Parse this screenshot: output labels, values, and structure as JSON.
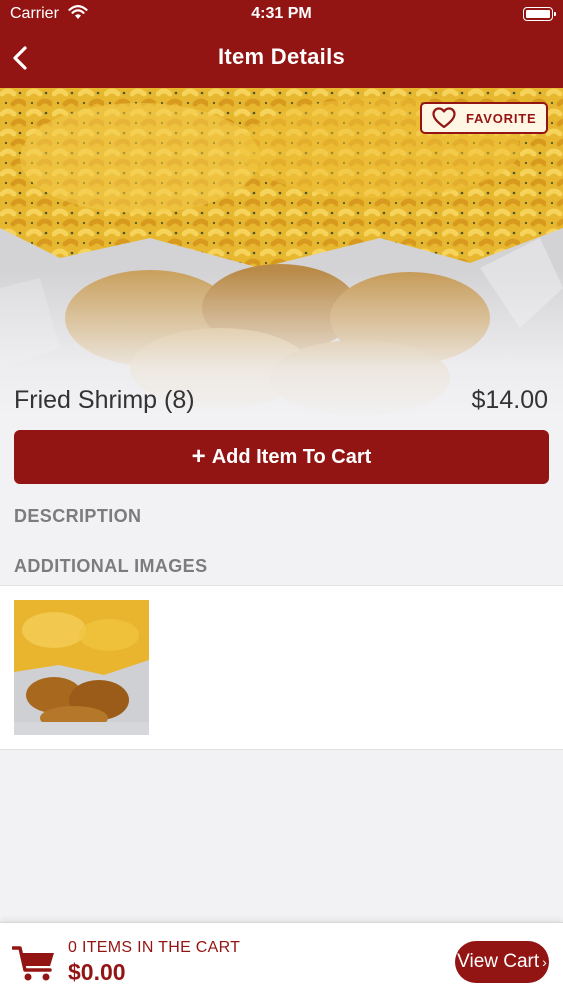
{
  "status_bar": {
    "carrier": "Carrier",
    "time": "4:31 PM"
  },
  "nav": {
    "title": "Item Details"
  },
  "favorite": {
    "label": "FAVORITE"
  },
  "item": {
    "name": "Fried Shrimp (8)",
    "price": "$14.00"
  },
  "add_to_cart": {
    "plus": "+",
    "label": "Add Item To Cart"
  },
  "sections": {
    "description": "DESCRIPTION",
    "additional_images": "ADDITIONAL IMAGES"
  },
  "cart": {
    "count_label": "0 ITEMS IN THE CART",
    "total": "$0.00",
    "view_label": "View Cart",
    "view_chevron": "›"
  },
  "colors": {
    "brand": "#931513",
    "background": "#f2f2f4",
    "favorite_bg": "#fff7e4"
  },
  "icons": [
    "chevron-left-icon",
    "wifi-icon",
    "battery-icon",
    "heart-icon",
    "cart-icon",
    "chevron-right-icon"
  ]
}
